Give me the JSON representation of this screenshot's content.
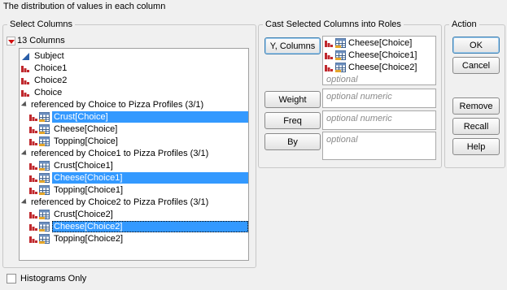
{
  "hint": "The distribution of values in each column",
  "select_columns": {
    "legend": "Select Columns",
    "count_label": "13 Columns",
    "rows": [
      {
        "label": "Subject",
        "kind": "continuous",
        "indent": 0,
        "selected": false
      },
      {
        "label": "Choice1",
        "kind": "nominal",
        "indent": 0,
        "selected": false
      },
      {
        "label": "Choice2",
        "kind": "nominal",
        "indent": 0,
        "selected": false
      },
      {
        "label": "Choice",
        "kind": "nominal",
        "indent": 0,
        "selected": false
      },
      {
        "label": "referenced by Choice to Pizza Profiles (3/1)",
        "kind": "group",
        "indent": 0,
        "selected": false
      },
      {
        "label": "Crust[Choice]",
        "kind": "ref",
        "indent": 1,
        "selected": true
      },
      {
        "label": "Cheese[Choice]",
        "kind": "ref",
        "indent": 1,
        "selected": false
      },
      {
        "label": "Topping[Choice]",
        "kind": "ref",
        "indent": 1,
        "selected": false
      },
      {
        "label": "referenced by Choice1 to Pizza Profiles (3/1)",
        "kind": "group",
        "indent": 0,
        "selected": false
      },
      {
        "label": "Crust[Choice1]",
        "kind": "ref",
        "indent": 1,
        "selected": false
      },
      {
        "label": "Cheese[Choice1]",
        "kind": "ref",
        "indent": 1,
        "selected": true
      },
      {
        "label": "Topping[Choice1]",
        "kind": "ref",
        "indent": 1,
        "selected": false
      },
      {
        "label": "referenced by Choice2 to Pizza Profiles (3/1)",
        "kind": "group",
        "indent": 0,
        "selected": false
      },
      {
        "label": "Crust[Choice2]",
        "kind": "ref",
        "indent": 1,
        "selected": false
      },
      {
        "label": "Cheese[Choice2]",
        "kind": "ref",
        "indent": 1,
        "selected": true,
        "focused": true
      },
      {
        "label": "Topping[Choice2]",
        "kind": "ref",
        "indent": 1,
        "selected": false
      }
    ]
  },
  "cast": {
    "legend": "Cast Selected Columns into Roles",
    "roles": [
      {
        "button": "Y, Columns",
        "items": [
          "Cheese[Choice]",
          "Cheese[Choice1]",
          "Cheese[Choice2]"
        ],
        "placeholder": "optional"
      },
      {
        "button": "Weight",
        "items": [],
        "placeholder": "optional numeric"
      },
      {
        "button": "Freq",
        "items": [],
        "placeholder": "optional numeric"
      },
      {
        "button": "By",
        "items": [],
        "placeholder": "optional"
      }
    ]
  },
  "action": {
    "legend": "Action",
    "buttons": [
      "OK",
      "Cancel",
      "Remove",
      "Recall",
      "Help"
    ]
  },
  "histograms_only": {
    "label": "Histograms Only",
    "checked": false
  },
  "colors": {
    "selection": "#3399ff",
    "nominal_icon": "#c0282d",
    "continuous_icon": "#2a5ea8",
    "menu_triangle": "#d01010"
  }
}
